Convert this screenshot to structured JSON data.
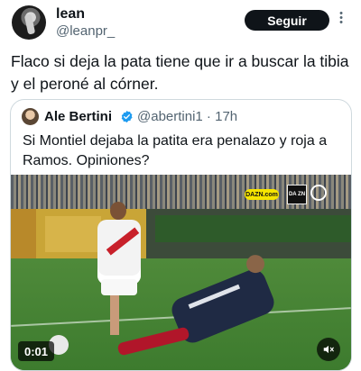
{
  "tweet": {
    "author_name": "lean",
    "author_handle": "@leanpr_",
    "follow_label": "Seguir",
    "more_icon": "more-vertical-icon",
    "text": "Flaco si deja la pata tiene que ir a buscar la tibia y el peroné al córner."
  },
  "quote": {
    "author_name": "Ale Bertini",
    "verified_icon": "verified-badge-icon",
    "verified_color": "#1d9bf0",
    "author_handle": "@abertini1 · 17h",
    "text": "Si Montiel dejaba la patita era penalazo y roja a Ramos. Opiniones?",
    "media": {
      "type": "video",
      "duration": "0:01",
      "broadcaster_badge": "DAZN.com",
      "broadcaster_logo": "DA ZN",
      "mute_icon": "volume-muted-icon"
    }
  },
  "colors": {
    "text_primary": "#0f1419",
    "text_secondary": "#536471",
    "follow_bg": "#0f1419",
    "border": "#cfd9de"
  }
}
